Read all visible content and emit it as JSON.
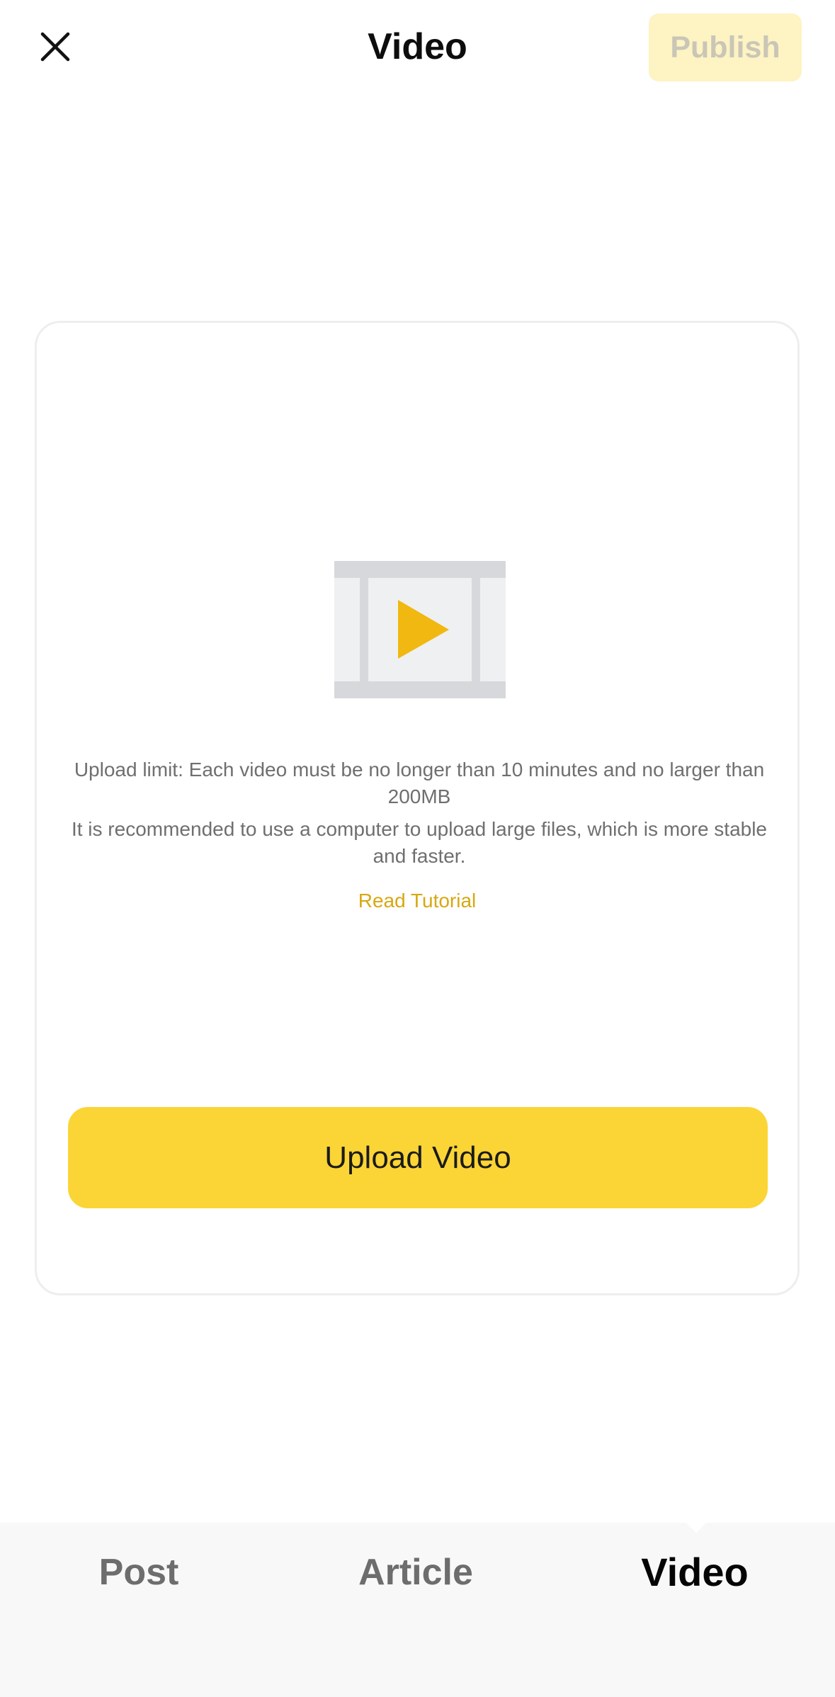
{
  "header": {
    "title": "Video",
    "publish_label": "Publish"
  },
  "upload": {
    "limit_text": "Upload limit: Each video must be no longer than 10 minutes and no larger than 200MB",
    "recommendation_text": "It is recommended to use a computer to upload large files, which is more stable and faster.",
    "tutorial_label": "Read Tutorial",
    "button_label": "Upload Video"
  },
  "tabs": [
    {
      "label": "Post",
      "active": false
    },
    {
      "label": "Article",
      "active": false
    },
    {
      "label": "Video",
      "active": true
    }
  ],
  "icons": {
    "close": "close-icon",
    "video_illustration": "video-film-icon"
  },
  "colors": {
    "accent": "#fbd535",
    "publish_disabled_bg": "#fdf3c3",
    "link": "#d7a812",
    "play": "#f0b810"
  }
}
